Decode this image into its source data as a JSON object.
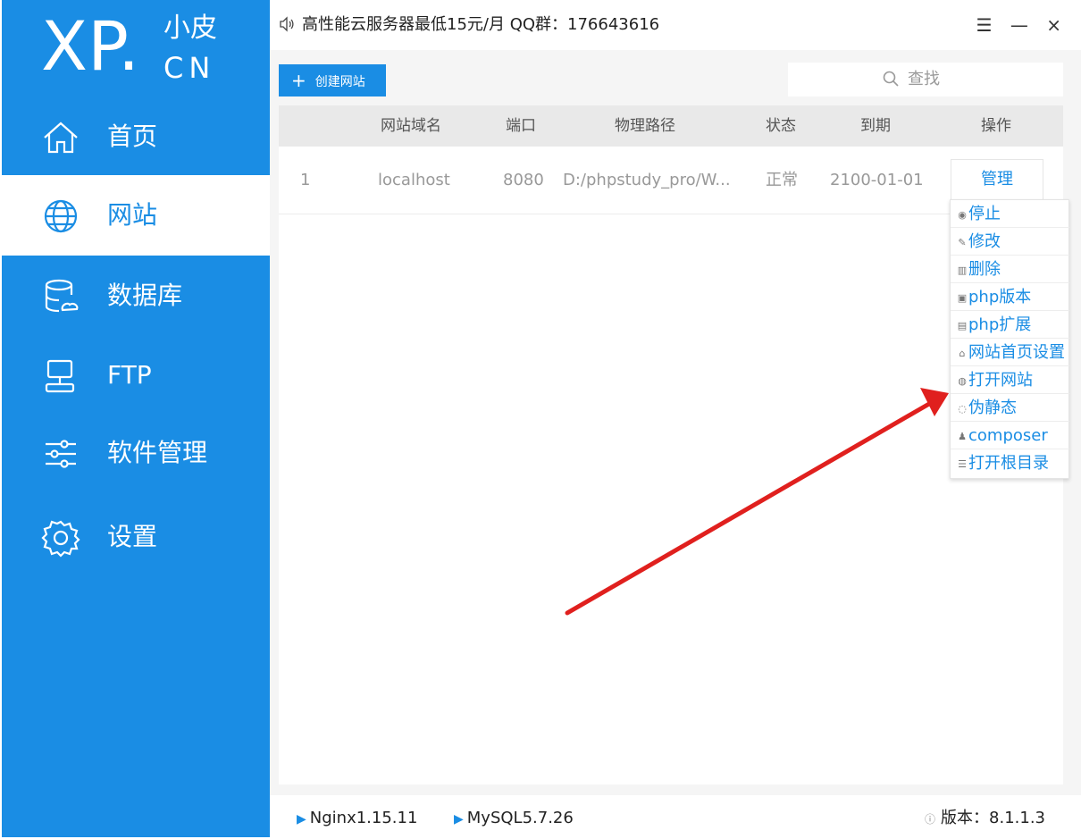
{
  "logo": {
    "main": "XP.",
    "cn_top": "小皮",
    "cn_bottom": "CN"
  },
  "nav": [
    {
      "label": "首页",
      "icon": "home-icon",
      "active": false
    },
    {
      "label": "网站",
      "icon": "globe-icon",
      "active": true
    },
    {
      "label": "数据库",
      "icon": "database-icon",
      "active": false
    },
    {
      "label": "FTP",
      "icon": "ftp-icon",
      "active": false
    },
    {
      "label": "软件管理",
      "icon": "sliders-icon",
      "active": false
    },
    {
      "label": "设置",
      "icon": "gear-icon",
      "active": false
    }
  ],
  "topbar": {
    "notice": "高性能云服务器最低15元/月  QQ群：176643616",
    "menu_glyph": "☰",
    "minimize_glyph": "—",
    "close_glyph": "×"
  },
  "toolbar": {
    "create_label": "创建网站",
    "search_placeholder": "查找"
  },
  "table": {
    "headers": [
      "网站域名",
      "端口",
      "物理路径",
      "状态",
      "到期",
      "操作"
    ],
    "rows": [
      {
        "index": "1",
        "domain": "localhost",
        "port": "8080",
        "path": "D:/phpstudy_pro/W...",
        "status": "正常",
        "expire": "2100-01-01",
        "action": "管理"
      }
    ]
  },
  "dropdown": [
    {
      "label": "停止",
      "icon": "stop-icon"
    },
    {
      "label": "修改",
      "icon": "pencil-icon"
    },
    {
      "label": "删除",
      "icon": "trash-icon"
    },
    {
      "label": "php版本",
      "icon": "php-version-icon"
    },
    {
      "label": "php扩展",
      "icon": "php-extension-icon"
    },
    {
      "label": "网站首页设置",
      "icon": "home-small-icon"
    },
    {
      "label": "打开网站",
      "icon": "globe-small-icon"
    },
    {
      "label": "伪静态",
      "icon": "rewrite-icon"
    },
    {
      "label": "composer",
      "icon": "composer-icon"
    },
    {
      "label": "打开根目录",
      "icon": "list-icon"
    }
  ],
  "statusbar": {
    "nginx": "Nginx1.15.11",
    "mysql": "MySQL5.7.26",
    "version": "版本：8.1.1.3"
  },
  "colors": {
    "accent": "#1a8de4",
    "arrow": "#e0201e"
  }
}
